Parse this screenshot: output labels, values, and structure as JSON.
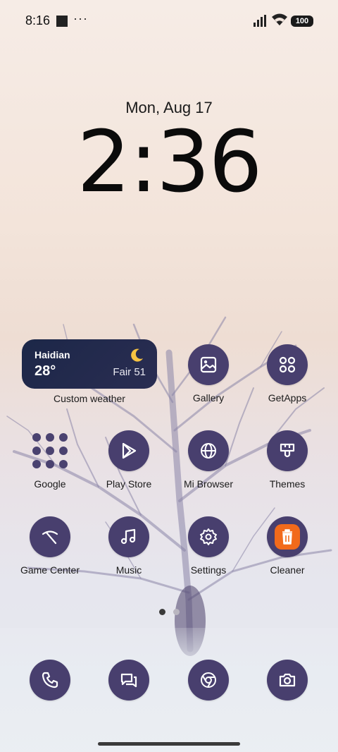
{
  "status_bar": {
    "time": "8:16",
    "more": "···",
    "battery": "100"
  },
  "lockscreen": {
    "date": "Mon, Aug 17",
    "clock": "2:36"
  },
  "weather_widget": {
    "city": "Haidian",
    "temp": "28°",
    "condition": "Fair 51",
    "label": "Custom weather",
    "icon": "moon-icon"
  },
  "apps": [
    {
      "label": "Gallery",
      "icon": "gallery-icon"
    },
    {
      "label": "GetApps",
      "icon": "getapps-icon"
    },
    {
      "label": "Google",
      "icon": "google-folder-icon"
    },
    {
      "label": "Play Store",
      "icon": "play-store-icon"
    },
    {
      "label": "Mi Browser",
      "icon": "browser-icon"
    },
    {
      "label": "Themes",
      "icon": "themes-icon"
    },
    {
      "label": "Game Center",
      "icon": "game-center-icon"
    },
    {
      "label": "Music",
      "icon": "music-icon"
    },
    {
      "label": "Settings",
      "icon": "settings-icon"
    },
    {
      "label": "Cleaner",
      "icon": "cleaner-icon"
    }
  ],
  "dock": [
    {
      "icon": "phone-icon"
    },
    {
      "icon": "messages-icon"
    },
    {
      "icon": "chrome-icon"
    },
    {
      "icon": "camera-icon"
    }
  ],
  "colors": {
    "icon_bg": "#483f6e",
    "widget_bg": "#1c2748",
    "cleaner_accent": "#f26a1b",
    "moon": "#f5c242"
  },
  "page_indicator": {
    "current": 1,
    "total": 2
  }
}
